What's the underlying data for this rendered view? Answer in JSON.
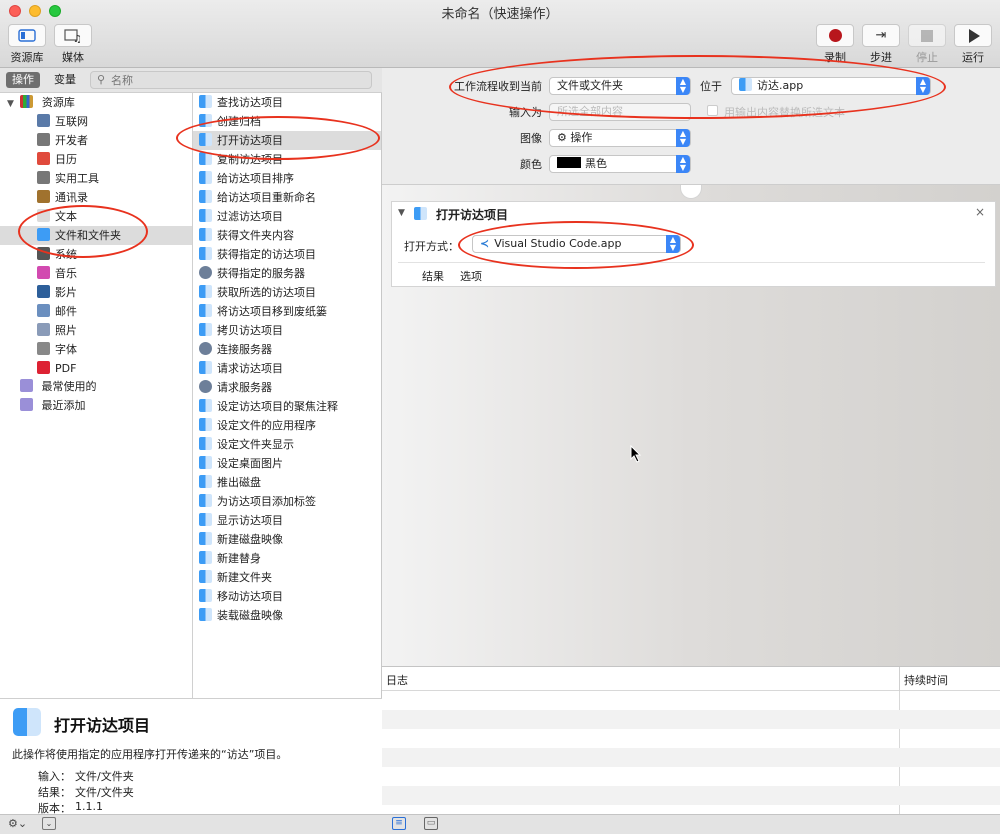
{
  "window": {
    "title": "未命名（快速操作）"
  },
  "toolbar": {
    "library_label": "资源库",
    "media_label": "媒体",
    "record_label": "录制",
    "step_label": "步进",
    "stop_label": "停止",
    "run_label": "运行"
  },
  "sidebar": {
    "tab_actions": "操作",
    "tab_variables": "变量",
    "search_placeholder": "名称",
    "library_root": "资源库",
    "categories": [
      {
        "label": "互联网",
        "icon": "globe-icon"
      },
      {
        "label": "开发者",
        "icon": "tools-icon"
      },
      {
        "label": "日历",
        "icon": "calendar-icon"
      },
      {
        "label": "实用工具",
        "icon": "tools-icon"
      },
      {
        "label": "通讯录",
        "icon": "contacts-icon"
      },
      {
        "label": "文本",
        "icon": "text-icon"
      },
      {
        "label": "文件和文件夹",
        "icon": "finder-icon"
      },
      {
        "label": "系统",
        "icon": "system-icon"
      },
      {
        "label": "音乐",
        "icon": "music-icon"
      },
      {
        "label": "影片",
        "icon": "movie-icon"
      },
      {
        "label": "邮件",
        "icon": "mail-icon"
      },
      {
        "label": "照片",
        "icon": "photo-icon"
      },
      {
        "label": "字体",
        "icon": "font-icon"
      },
      {
        "label": "PDF",
        "icon": "pdf-icon"
      }
    ],
    "smart_groups": [
      "最常使用的",
      "最近添加"
    ]
  },
  "actions": [
    "查找访达项目",
    "创建归档",
    "打开访达项目",
    "复制访达项目",
    "给访达项目排序",
    "给访达项目重新命名",
    "过滤访达项目",
    "获得文件夹内容",
    "获得指定的访达项目",
    "获得指定的服务器",
    "获取所选的访达项目",
    "将访达项目移到废纸篓",
    "拷贝访达项目",
    "连接服务器",
    "请求访达项目",
    "请求服务器",
    "设定访达项目的聚焦注释",
    "设定文件的应用程序",
    "设定文件夹显示",
    "设定桌面图片",
    "推出磁盘",
    "为访达项目添加标签",
    "显示访达项目",
    "新建磁盘映像",
    "新建替身",
    "新建文件夹",
    "移动访达项目",
    "装载磁盘映像"
  ],
  "description": {
    "title": "打开访达项目",
    "text": "此操作将使用指定的应用程序打开传递来的“访达”项目。",
    "input_label": "输入：",
    "input_value": "文件/文件夹",
    "result_label": "结果：",
    "result_value": "文件/文件夹",
    "version_label": "版本：",
    "version_value": "1.1.1"
  },
  "workflow": {
    "receives_label": "工作流程收到当前",
    "receives_value": "文件或文件夹",
    "in_label": "位于",
    "in_value": "访达.app",
    "input_is_label": "输入为",
    "input_is_value": "所选全部内容",
    "replace_label": "用输出内容替换所选文本",
    "image_label": "图像",
    "image_value": "操作",
    "color_label": "颜色",
    "color_value": "黑色"
  },
  "action_card": {
    "title": "打开访达项目",
    "open_with_label": "打开方式：",
    "open_with_value": "Visual Studio Code.app",
    "tab_results": "结果",
    "tab_options": "选项"
  },
  "log": {
    "col_log": "日志",
    "col_duration": "持续时间"
  },
  "colors": {
    "accent": "#3b86f7",
    "record": "#b8161c",
    "annotation": "#e8321e"
  }
}
